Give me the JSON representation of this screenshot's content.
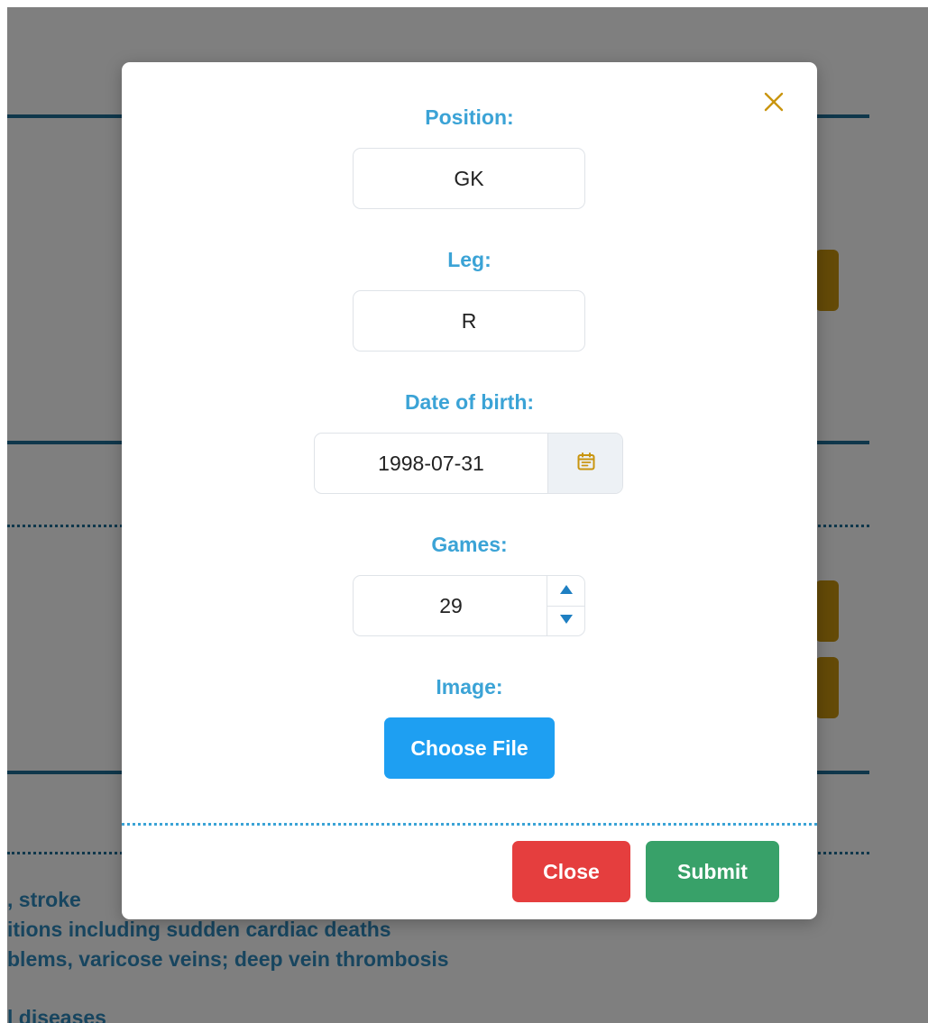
{
  "background": {
    "text_lines": [
      ", stroke",
      "itions including sudden cardiac deaths",
      "blems, varicose veins; deep vein thrombosis",
      "l diseases"
    ]
  },
  "modal": {
    "fields": {
      "position": {
        "label": "Position:",
        "value": "GK"
      },
      "leg": {
        "label": "Leg:",
        "value": "R"
      },
      "dob": {
        "label": "Date of birth:",
        "value": "1998-07-31"
      },
      "games": {
        "label": "Games:",
        "value": "29"
      },
      "image": {
        "label": "Image:",
        "button_label": "Choose File"
      }
    },
    "footer": {
      "close_label": "Close",
      "submit_label": "Submit"
    },
    "icons": {
      "close": "close-icon",
      "calendar": "calendar-icon",
      "spin_up": "caret-up-icon",
      "spin_down": "caret-down-icon"
    }
  },
  "colors": {
    "label": "#3ba3d6",
    "accent": "#c9950f",
    "file_button": "#1e9ff2",
    "close_button": "#e53e3e",
    "submit_button": "#38a169",
    "backdrop": "rgba(0,0,0,0.5)"
  }
}
